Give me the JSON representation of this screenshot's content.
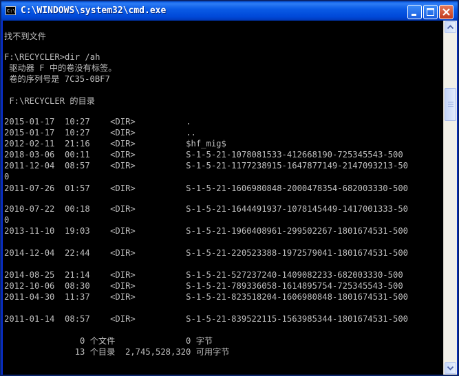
{
  "window": {
    "title": "C:\\WINDOWS\\system32\\cmd.exe",
    "icon_text": "C:\\"
  },
  "console": {
    "lines": [
      "找不到文件",
      "",
      "F:\\RECYCLER>dir /ah",
      " 驱动器 F 中的卷没有标签。",
      " 卷的序列号是 7C35-0BF7",
      "",
      " F:\\RECYCLER 的目录",
      "",
      "2015-01-17  10:27    <DIR>          .",
      "2015-01-17  10:27    <DIR>          ..",
      "2012-02-11  21:16    <DIR>          $hf_mig$",
      "2018-03-06  00:11    <DIR>          S-1-5-21-1078081533-412668190-725345543-500",
      "2011-12-04  08:57    <DIR>          S-1-5-21-1177238915-1647877149-2147093213-50",
      "0",
      "2011-07-26  01:57    <DIR>          S-1-5-21-1606980848-2000478354-682003330-500",
      "",
      "2010-07-22  00:18    <DIR>          S-1-5-21-1644491937-1078145449-1417001333-50",
      "0",
      "2013-11-10  19:03    <DIR>          S-1-5-21-1960408961-299502267-1801674531-500",
      "",
      "2014-12-04  22:44    <DIR>          S-1-5-21-220523388-1972579041-1801674531-500",
      "",
      "2014-08-25  21:14    <DIR>          S-1-5-21-527237240-1409082233-682003330-500",
      "2012-10-06  08:30    <DIR>          S-1-5-21-789336058-1614895754-725345543-500",
      "2011-04-30  11:37    <DIR>          S-1-5-21-823518204-1606980848-1801674531-500",
      "",
      "2011-01-14  08:57    <DIR>          S-1-5-21-839522115-1563985344-1801674531-500",
      "",
      "               0 个文件              0 字节",
      "              13 个目录  2,745,528,320 可用字节"
    ]
  },
  "colors": {
    "console_bg": "#000000",
    "console_text": "#c0c0c0",
    "titlebar": "#0a5be6"
  }
}
